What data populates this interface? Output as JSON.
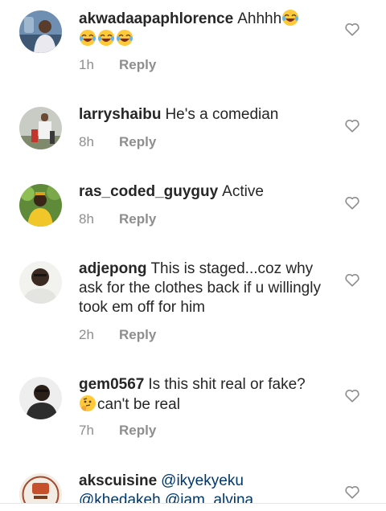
{
  "comments": [
    {
      "username": "akwadaapaphlorence",
      "text": "Ahhhh",
      "emoji_after_text": "laughing-crying-emoji",
      "emoji_line": [
        "laughing-crying-emoji",
        "laughing-crying-emoji",
        "laughing-crying-emoji"
      ],
      "time": "1h",
      "reply": "Reply"
    },
    {
      "username": "larryshaibu",
      "text": "He's a comedian",
      "time": "8h",
      "reply": "Reply"
    },
    {
      "username": "ras_coded_guyguy",
      "text": "Active",
      "time": "8h",
      "reply": "Reply"
    },
    {
      "username": "adjepong",
      "text": "This is staged...coz why ask for the clothes back if u willingly took em off for him",
      "time": "2h",
      "reply": "Reply"
    },
    {
      "username": "gem0567",
      "text": "Is this shit real or fake?",
      "line2": "can't be real",
      "emoji_before_line2": "thinking-face-emoji",
      "time": "7h",
      "reply": "Reply"
    },
    {
      "username": "akscuisine",
      "mentions": [
        "@ikyekyeku",
        "@khedakeh",
        "@iam_alvina"
      ]
    }
  ],
  "colors": {
    "text": "#262626",
    "meta": "#8e8e8e",
    "mention": "#00376b",
    "heart": "#8e8e8e"
  },
  "icons": {
    "like": "heart-outline-icon"
  }
}
